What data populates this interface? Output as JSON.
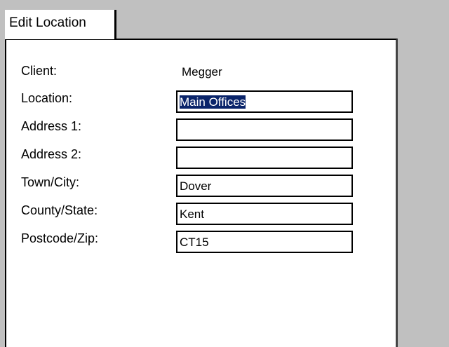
{
  "tab": {
    "title": "Edit Location"
  },
  "form": {
    "client_label": "Client:",
    "client_value": "Megger",
    "location_label": "Location:",
    "location_value": "Main Offices",
    "address1_label": "Address 1:",
    "address1_value": "",
    "address2_label": "Address 2:",
    "address2_value": "",
    "town_label": "Town/City:",
    "town_value": "Dover",
    "county_label": "County/State:",
    "county_value": "Kent",
    "postcode_label": "Postcode/Zip:",
    "postcode_value": "CT15"
  },
  "colors": {
    "background": "#c0c0c0",
    "panel": "#ffffff",
    "selection": "#0a246a"
  }
}
